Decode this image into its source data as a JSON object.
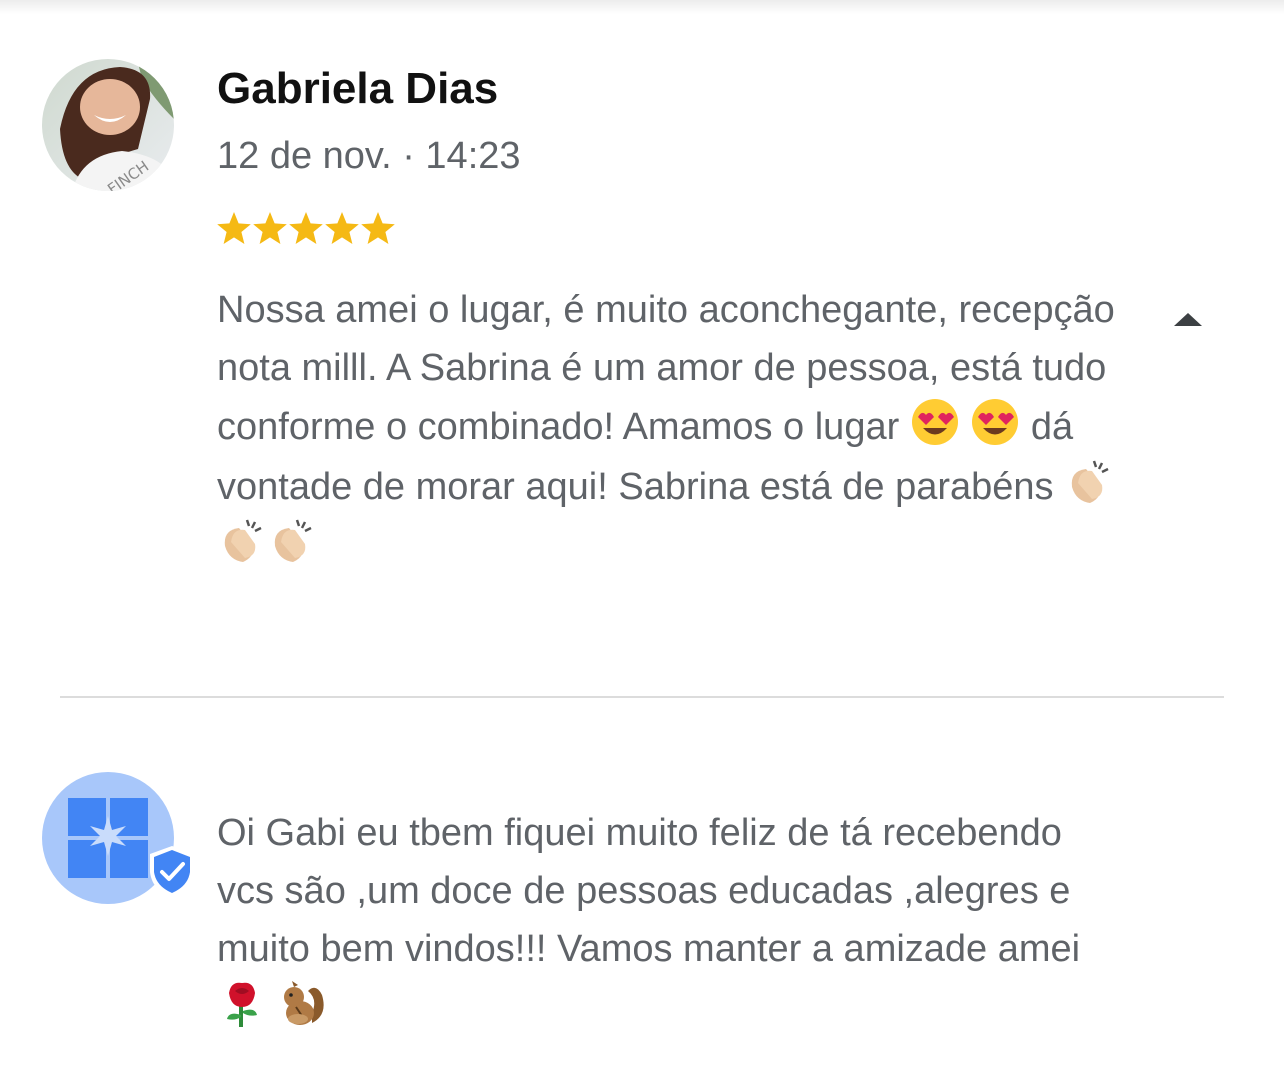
{
  "review": {
    "author": "Gabriela Dias",
    "date_time": "12 de nov. · 14:23",
    "rating": 5,
    "rating_max": 5,
    "avatar_shirt_text": "FINCH",
    "text_part1": "Nossa amei o lugar, é muito aconchegante, recepção nota milll. A Sabrina é um amor de pessoa, está tudo conforme o combinado! Amamos o lugar ",
    "text_part2": " dá vontade de morar aqui! Sabrina está de parabéns ",
    "emoji_set_1": "heart-eyes-emoji",
    "emoji_set_2": "clapping-hands-emoji",
    "toggle_icon": "collapse-arrow-icon"
  },
  "reply": {
    "text": "Oi Gabi eu tbem fiquei muito feliz de tá recebendo vcs são ,um doce de pessoas educadas ,alegres e muito bem vindos!!! Vamos manter a amizade amei",
    "emojis": [
      "rose-emoji",
      "chipmunk-emoji"
    ],
    "avatar_icon": "owner-verified-badge-icon"
  },
  "colors": {
    "star": "#f5b914",
    "name": "#111111",
    "body_text": "#5f6368",
    "divider": "#dcdcdc",
    "owner_avatar_bg": "#a8c7fa",
    "owner_icon": "#4285f4"
  }
}
